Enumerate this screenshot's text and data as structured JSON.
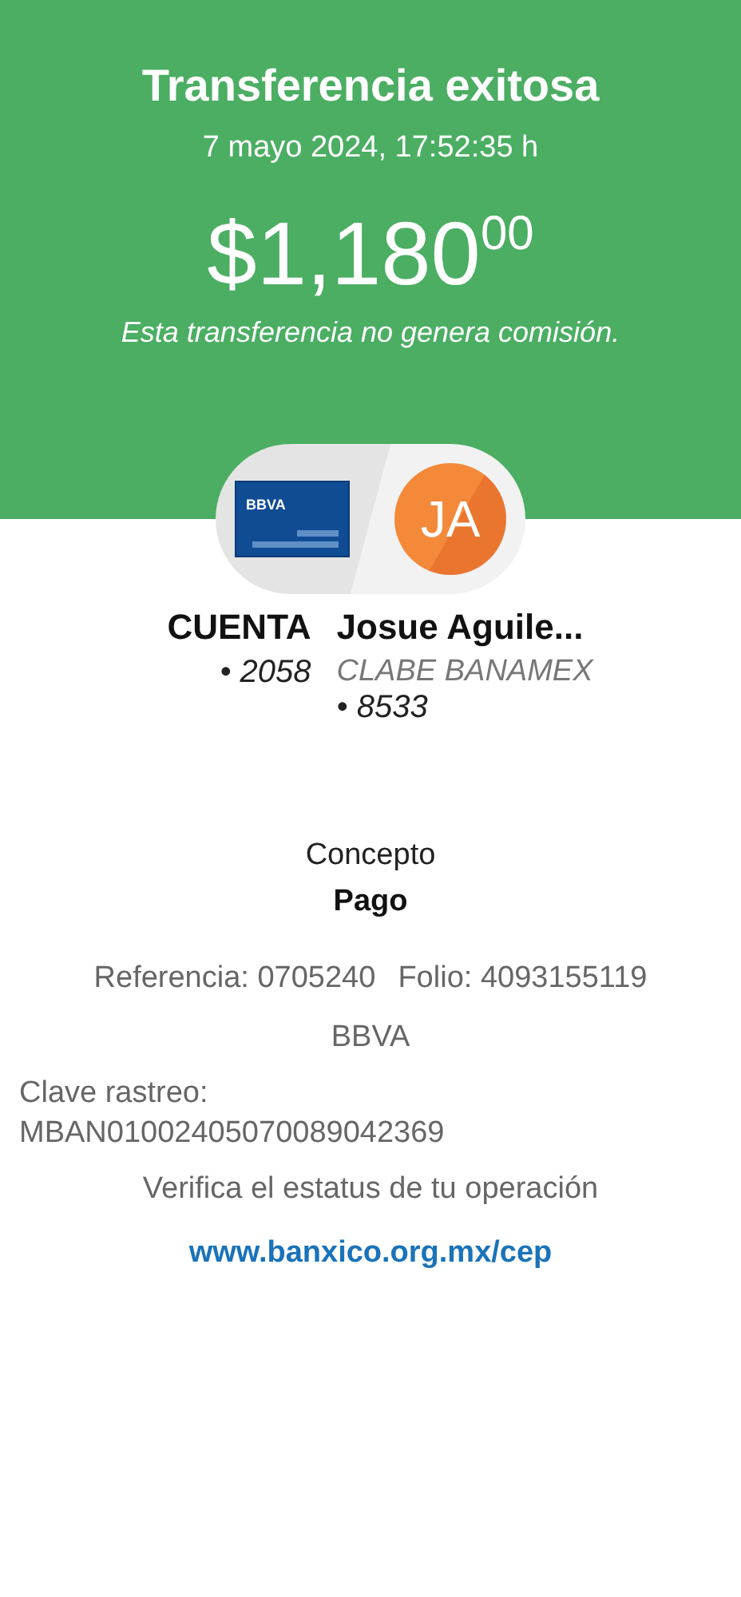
{
  "header": {
    "title": "Transferencia exitosa",
    "datetime": "7 mayo 2024, 17:52:35 h",
    "amount": "$1,180$^{00}$",
    "note": "Esta transferencia no genera comisión."
  },
  "parties": {
    "card_brand": "BBVA",
    "avatar_initials": "JA",
    "origin": {
      "name": "CUENTA",
      "account": "• 2058"
    },
    "destination": {
      "name": "Josue Aguile...",
      "bank": "CLABE BANAMEX",
      "account": "• 8533"
    }
  },
  "concept": {
    "label": "Concepto",
    "value": "Pago"
  },
  "reference": "Referencia: 0705240",
  "folio": "Folio: 4093155119",
  "bank": "BBVA",
  "tracking": {
    "label": "Clave rastreo:",
    "value": "MBAN01002405070089042369"
  },
  "verify": {
    "text": "Verifica el estatus de tu operación",
    "link": "www.banxico.org.mx/cep"
  }
}
